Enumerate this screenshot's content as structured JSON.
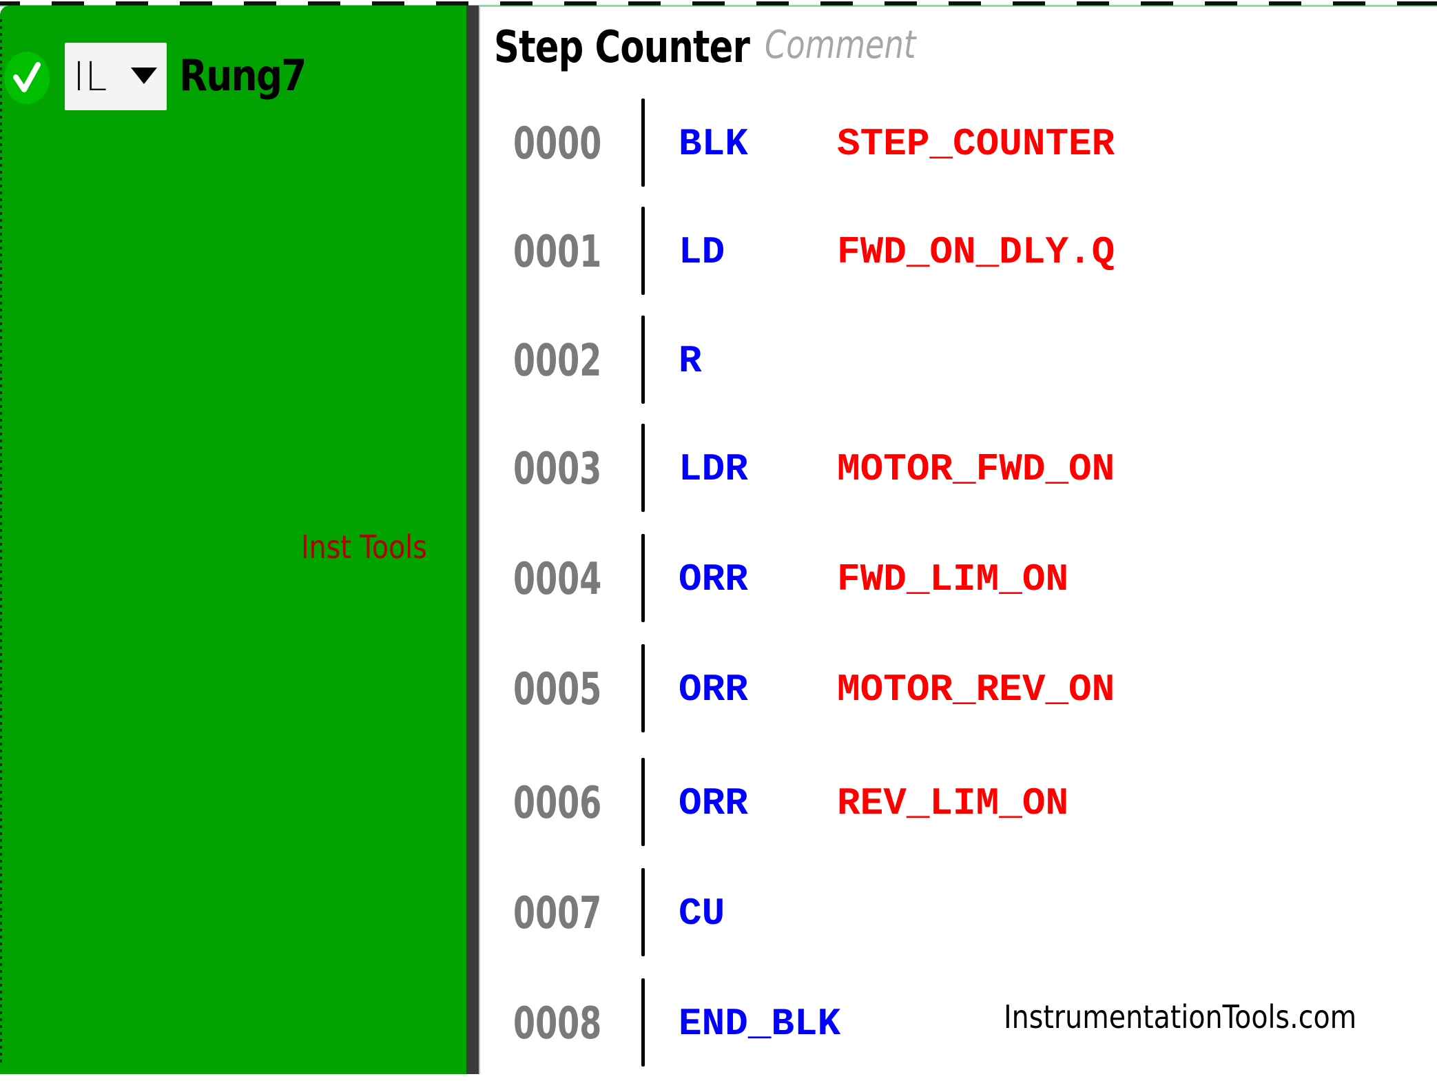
{
  "rung": {
    "status": "valid",
    "status_icon": "check-circle-icon",
    "language_selector": {
      "value": "IL",
      "icon": "caret-down-icon"
    },
    "name": "Rung7",
    "title": "Step Counter",
    "comment_placeholder": "Comment"
  },
  "instructions": [
    {
      "address": "0000",
      "op": "BLK",
      "operand": "STEP_COUNTER"
    },
    {
      "address": "0001",
      "op": "LD",
      "operand": "FWD_ON_DLY.Q"
    },
    {
      "address": "0002",
      "op": "R",
      "operand": ""
    },
    {
      "address": "0003",
      "op": "LDR",
      "operand": "MOTOR_FWD_ON"
    },
    {
      "address": "0004",
      "op": "ORR",
      "operand": "FWD_LIM_ON"
    },
    {
      "address": "0005",
      "op": "ORR",
      "operand": "MOTOR_REV_ON"
    },
    {
      "address": "0006",
      "op": "ORR",
      "operand": "REV_LIM_ON"
    },
    {
      "address": "0007",
      "op": "CU",
      "operand": ""
    },
    {
      "address": "0008",
      "op": "END_BLK",
      "operand": ""
    }
  ],
  "watermarks": {
    "left": "Inst Tools",
    "right": "InstrumentationTools.com"
  },
  "colors": {
    "rung_background": "#00a300",
    "status_ok": "#00bf00",
    "instruction": "#0000ff",
    "operand": "#ff0000",
    "address": "#7a7a7a",
    "watermark_left": "#b00000"
  }
}
